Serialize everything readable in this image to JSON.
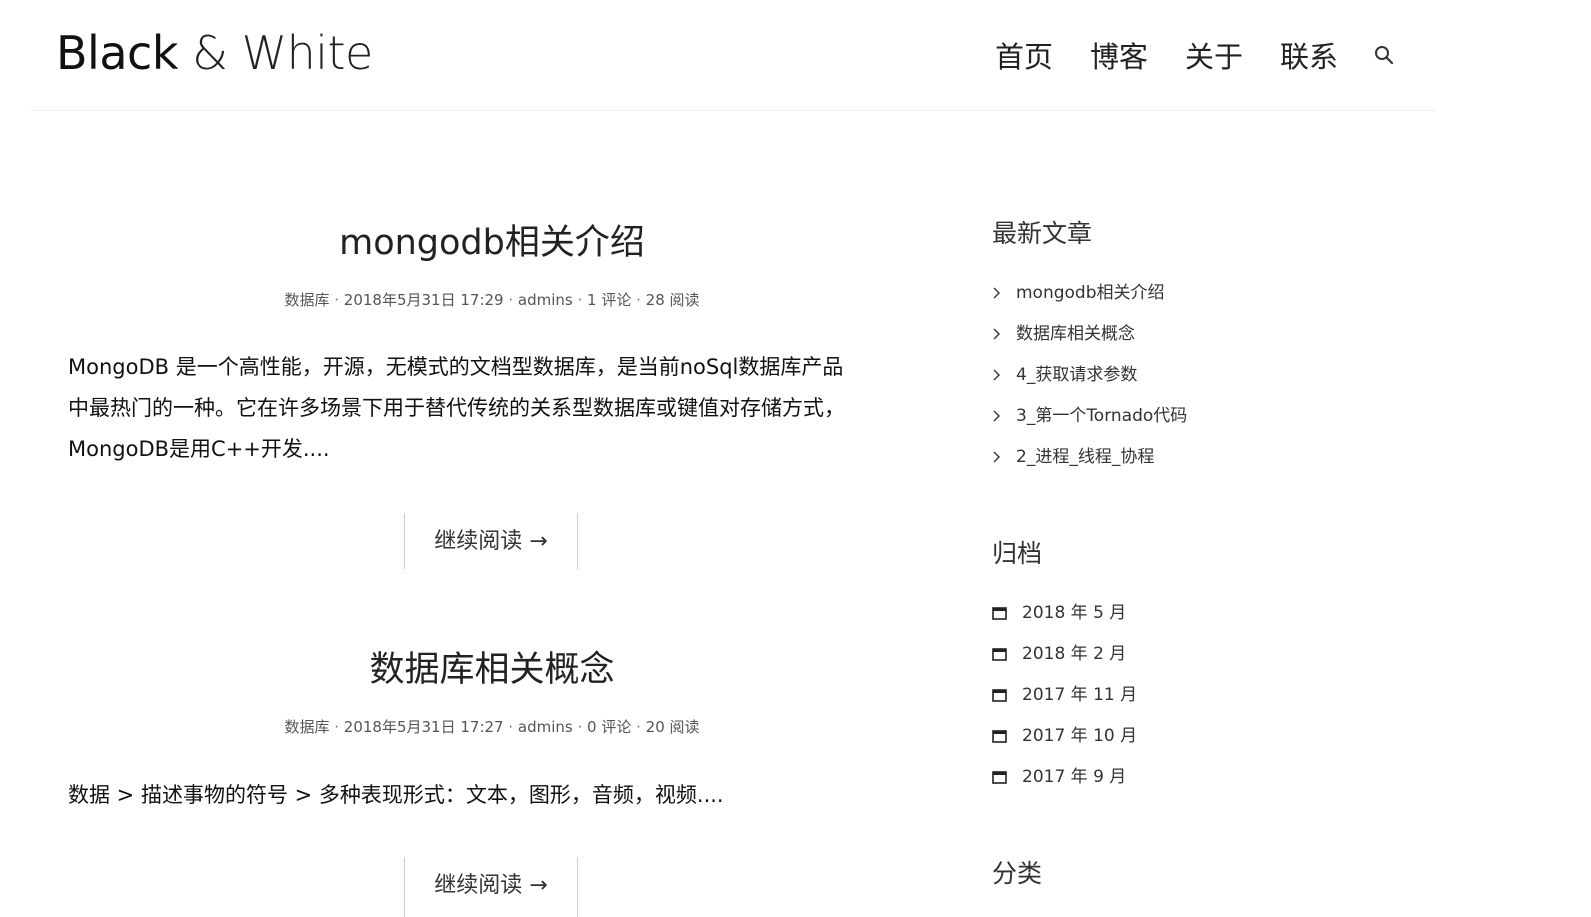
{
  "header": {
    "logo_part1": "Black",
    "logo_part2": "&",
    "logo_part3": "White",
    "nav": [
      "首页",
      "博客",
      "关于",
      "联系"
    ]
  },
  "posts": [
    {
      "title": "mongodb相关介绍",
      "category": "数据库",
      "date": "2018年5月31日 17:29",
      "author": "admins",
      "comments": "1 评论",
      "views": "28 阅读",
      "excerpt_lines": [
        "MongoDB 是一个高性能，开源，无模式的文档型数据库，是当前noSql数据库产品",
        "中最热门的一种。它在许多场景下用于替代传统的关系型数据库或键值对存储方式，",
        "MongoDB是用C++开发...."
      ],
      "read_more": "继续阅读 →"
    },
    {
      "title": "数据库相关概念",
      "category": "数据库",
      "date": "2018年5月31日 17:27",
      "author": "admins",
      "comments": "0 评论",
      "views": "20 阅读",
      "excerpt_lines": [
        "数据 > 描述事物的符号 > 多种表现形式：文本，图形，音频，视频...."
      ],
      "read_more": "继续阅读 →"
    }
  ],
  "sidebar": {
    "recent_title": "最新文章",
    "recent": [
      "mongodb相关介绍",
      "数据库相关概念",
      "4_获取请求参数",
      "3_第一个Tornado代码",
      "2_进程_线程_协程"
    ],
    "archive_title": "归档",
    "archive": [
      "2018 年 5 月",
      "2018 年 2 月",
      "2017 年 11 月",
      "2017 年 10 月",
      "2017 年 9 月"
    ],
    "category_title": "分类"
  },
  "meta_sep": " · "
}
